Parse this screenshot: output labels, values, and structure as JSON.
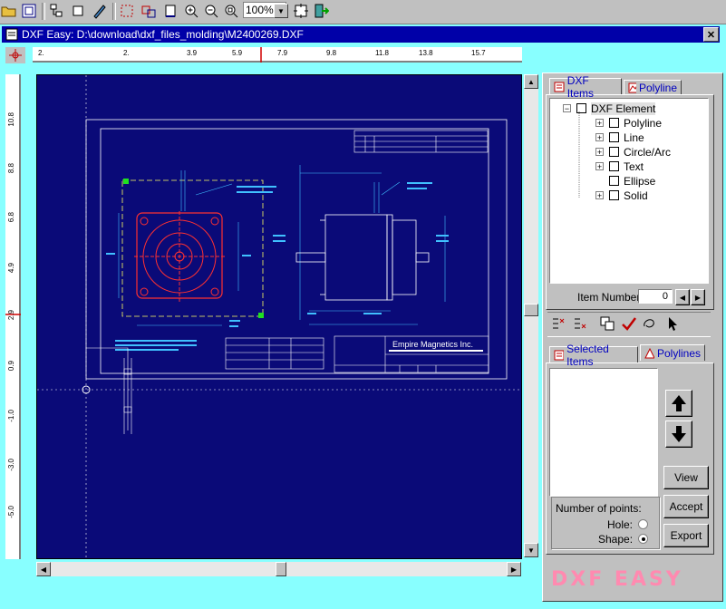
{
  "toolbar": {
    "zoom_value": "100%",
    "icons": [
      "open-folder-icon",
      "fit-window-icon",
      "hierarchy-icon",
      "select-icon",
      "edit-icon",
      "select-region-icon",
      "select-entities-icon",
      "window-icon",
      "zoom-in-icon",
      "zoom-out-icon",
      "zoom-fit-icon",
      "frame-icon",
      "exit-icon"
    ]
  },
  "window": {
    "title": "DXF Easy: D:\\download\\dxf_files_molding\\M2400269.DXF",
    "close_glyph": "✕"
  },
  "ruler_h": {
    "ticks": [
      "2.",
      "2.",
      "3.9",
      "5.9",
      "7.9",
      "9.8",
      "11.8",
      "13.8",
      "15.7"
    ]
  },
  "ruler_v": {
    "ticks": [
      "10.8",
      "8.8",
      "6.8",
      "4.9",
      "2.9",
      "0.9",
      "-1.0",
      "-3.0",
      "-5.0"
    ]
  },
  "drawing": {
    "company": "Empire Magnetics Inc."
  },
  "panel": {
    "tabs_top": {
      "dxf_items": "DXF Items",
      "polyline": "Polyline"
    },
    "tree": {
      "root": "DXF Element",
      "items": [
        "Polyline",
        "Line",
        "Circle/Arc",
        "Text",
        "Ellipse",
        "Solid"
      ]
    },
    "item_number_label": "Item Number",
    "item_number_value": "0",
    "tabs_bottom": {
      "selected_items": "Selected Items",
      "polylines": "Polylines"
    },
    "buttons": {
      "view": "View",
      "accept": "Accept",
      "export": "Export"
    },
    "points_group": {
      "title": "Number of points:",
      "hole_label": "Hole:",
      "shape_label": "Shape:",
      "selected": "shape"
    },
    "logo": "DXF EASY"
  },
  "colors": {
    "canvas": "#0a0a78",
    "titlebar": "#0000a8",
    "accent_cyan": "#88ffff",
    "cad_red": "#ff3030",
    "logo": "#ff8ab0"
  }
}
